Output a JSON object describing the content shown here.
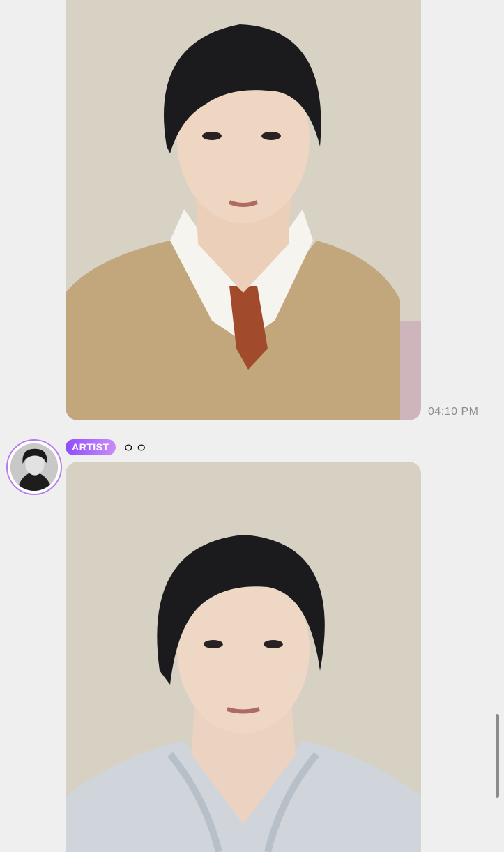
{
  "messages": [
    {
      "image_alt": "selfie in beige sweater with white collar and rust tie",
      "timestamp": "04:10 PM"
    },
    {
      "badge": "ARTIST",
      "sender": "ㅇㅇ",
      "image_alt": "selfie in pale patterned shirt"
    }
  ],
  "colors": {
    "background": "#efefef",
    "badge_gradient_start": "#8e4dff",
    "badge_gradient_end": "#c98cf5",
    "avatar_ring": "#b47cf0",
    "timestamp": "#8d8d8d"
  },
  "icons": {
    "avatar": "artist-avatar",
    "scrollbar": "scroll-thumb"
  }
}
